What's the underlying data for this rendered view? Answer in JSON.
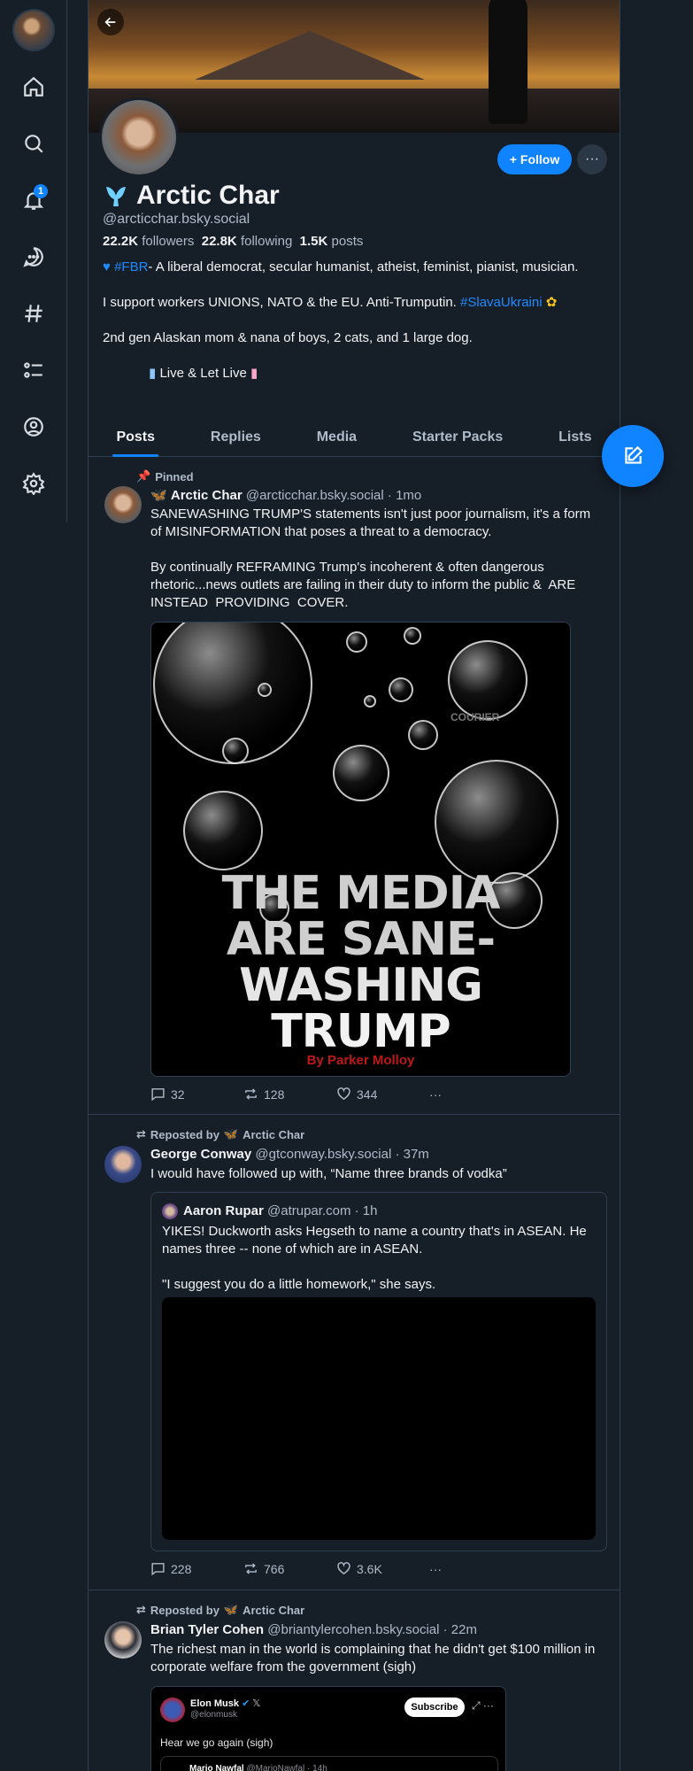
{
  "nav": {
    "notification_count": "1",
    "items": [
      "home-icon",
      "search-icon",
      "bell-icon",
      "chat-icon",
      "hashtag-icon",
      "list-icon",
      "profile-icon",
      "gear-icon"
    ]
  },
  "profile": {
    "display_name": "Arctic Char",
    "handle": "@arcticchar.bsky.social",
    "followers_count": "22.2K",
    "followers_label": "followers",
    "following_count": "22.8K",
    "following_label": "following",
    "posts_count": "1.5K",
    "posts_label": "posts",
    "follow_label": "Follow",
    "bio": {
      "line1_tag": "#FBR",
      "line1_rest": "- A liberal democrat, secular humanist, atheist, feminist, pianist, musician.",
      "line2_text": "I support workers UNIONS, NATO & the EU. Anti-Trumputin. ",
      "line2_tag": "#SlavaUkraini",
      "line3": "2nd gen Alaskan mom & nana of boys, 2 cats, and 1 large dog.",
      "line4": "Live & Let Live"
    }
  },
  "tabs": [
    "Posts",
    "Replies",
    "Media",
    "Starter Packs",
    "Lists"
  ],
  "posts": [
    {
      "context": "Pinned",
      "author": "Arctic Char",
      "handle": "@arcticchar.bsky.social",
      "time": "· 1mo",
      "text": "SANEWASHING TRUMP'S statements isn't just poor journalism, it's a form of MISINFORMATION that poses a threat to a democracy.\n\nBy continually REFRAMING Trump's incoherent & often dangerous rhetoric...news outlets are failing in their duty to inform the public &  ARE  INSTEAD  PROVIDING  COVER.",
      "image": {
        "title_line1": "THE MEDIA",
        "title_line2": "ARE SANE-",
        "title_line3": "WASHING",
        "title_line4": "TRUMP",
        "byline": "By Parker Molloy",
        "watermark": "COURIER"
      },
      "replies": "32",
      "reposts": "128",
      "likes": "344"
    },
    {
      "context": "Reposted by",
      "context_name": "Arctic Char",
      "author": "George Conway",
      "handle": "@gtconway.bsky.social",
      "time": "· 37m",
      "text": "I would have followed up with, “Name three brands of vodka”",
      "quote": {
        "author": "Aaron Rupar",
        "handle": "@atrupar.com",
        "time": "· 1h",
        "text": "YIKES! Duckworth asks Hegseth to name a country that's in ASEAN. He names three -- none of which are in ASEAN.\n\n\"I suggest you do a little homework,\" she says."
      },
      "replies": "228",
      "reposts": "766",
      "likes": "3.6K"
    },
    {
      "context": "Reposted by",
      "context_name": "Arctic Char",
      "author": "Brian Tyler Cohen",
      "handle": "@briantylercohen.bsky.social",
      "time": "· 22m",
      "text": "The richest man in the world is complaining that he didn't get $100 million in corporate welfare from the government (sigh)",
      "embed": {
        "name": "Elon Musk",
        "handle": "@elonmusk",
        "subscribe": "Subscribe",
        "text": "Hear we go again (sigh)",
        "inner_name": "Mario Nawfal",
        "inner_handle": "@MarioNawfal · 14h"
      }
    }
  ]
}
